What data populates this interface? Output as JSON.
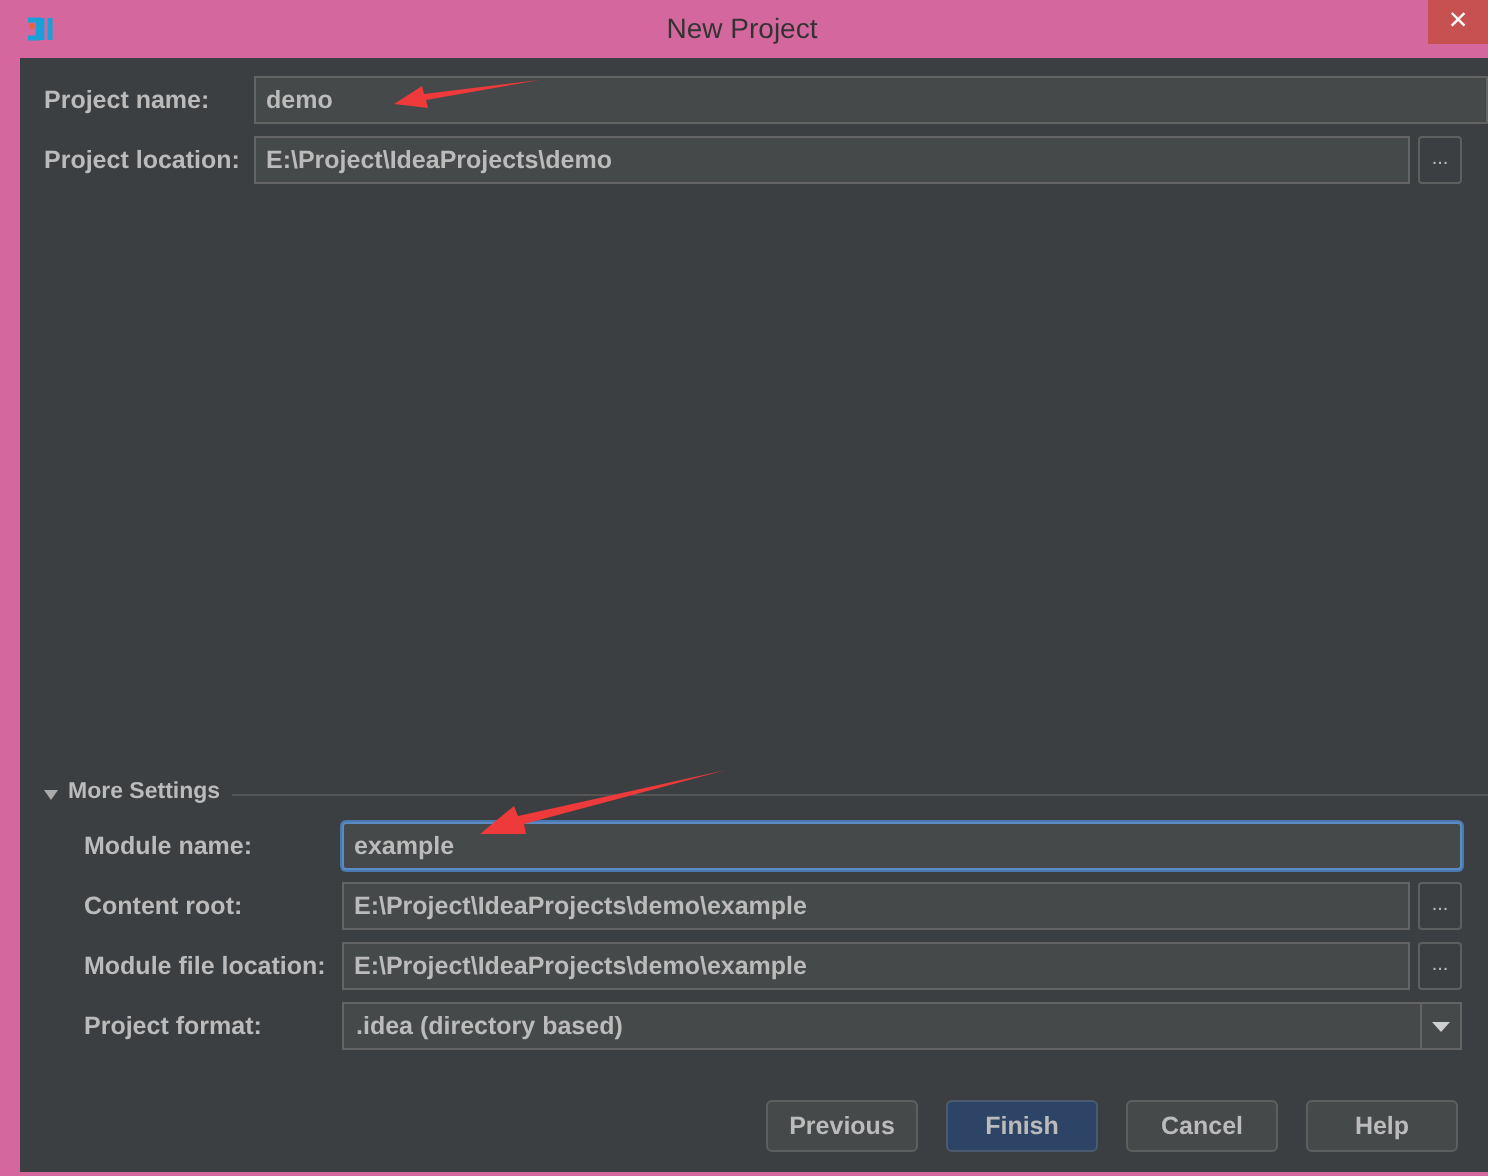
{
  "window": {
    "title": "New Project",
    "close": "×"
  },
  "project_fields": [
    {
      "label": "Project name:",
      "value": "demo",
      "focused": false
    },
    {
      "label": "Project location:",
      "value": "E:\\Project\\IdeaProjects\\demo",
      "focused": false,
      "browse": "..."
    }
  ],
  "more_settings": {
    "label": "More Settings",
    "expanded": true,
    "fields": [
      {
        "label": "Module name:",
        "value": "example",
        "kind": "input",
        "focused": true
      },
      {
        "label": "Content root:",
        "value": "E:\\Project\\IdeaProjects\\demo\\example",
        "kind": "input",
        "focused": false,
        "browse": "..."
      },
      {
        "label": "Module file location:",
        "value": "E:\\Project\\IdeaProjects\\demo\\example",
        "kind": "input",
        "focused": false,
        "browse": "..."
      },
      {
        "label": "Project format:",
        "value": ".idea (directory based)",
        "kind": "dropdown"
      }
    ]
  },
  "buttons": [
    {
      "label": "Previous",
      "default": false
    },
    {
      "label": "Finish",
      "default": true
    },
    {
      "label": "Cancel",
      "default": false
    },
    {
      "label": "Help",
      "default": false
    }
  ]
}
